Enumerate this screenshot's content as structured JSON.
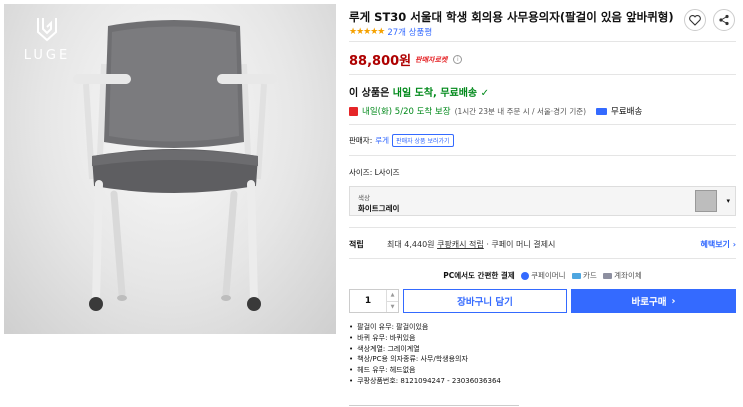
{
  "brand": {
    "logo_text": "LUGE"
  },
  "product": {
    "title": "루게 ST30 서울대 학생 회의용 사무용의자(팔걸이 있음 앞바퀴형)",
    "stars": "★★★★★",
    "review_count": "27개 상품평",
    "price": "88,800원",
    "rocket_badge": "판매자로켓",
    "info_glyph": "i"
  },
  "delivery": {
    "headline_prefix": "이 상품은 ",
    "headline_green": "내일 도착, 무료배송",
    "check": "✓",
    "arrival": "내일(화) 5/20 도착 보장",
    "arrival_note": "(1시간 23분  내 주문 시 / 서울·경기 기준)",
    "shipping": "무료배송"
  },
  "seller": {
    "label": "판매자:",
    "name": "루게",
    "more_button": "판매자 상품 보러가기"
  },
  "options": {
    "size_label": "사이즈: L사이즈",
    "color_small_label": "색상",
    "color_value": "화이트그레이",
    "caret": "▾"
  },
  "points": {
    "label": "적립",
    "detail_prefix": "최대 4,440원 ",
    "detail_link": "쿠팡캐시 적립",
    "detail_suffix": " · 쿠페이 머니 결제시",
    "more": "혜택보기 ›"
  },
  "payment": {
    "headline": "PC에서도 간편한 결제",
    "options": [
      "쿠페이머니",
      "카드",
      "계좌이체"
    ]
  },
  "purchase": {
    "quantity": "1",
    "up": "▲",
    "down": "▼",
    "cart_label": "장바구니 담기",
    "buy_label": "바로구매",
    "buy_arrow": "›"
  },
  "specs": [
    "팔걸이 유무: 팔걸이있음",
    "바퀴 유무: 바퀴있음",
    "색상계열: 그레이계열",
    "책상/PC용 의자종류: 사무/학생용의자",
    "헤드 유무: 헤드없음",
    "쿠팡상품번호: 8121094247 - 23036036364"
  ],
  "icons": {
    "heart": "heart-icon",
    "share": "share-icon",
    "calendar": "calendar-icon",
    "truck": "truck-icon"
  },
  "colors": {
    "accent": "#346aff",
    "price": "#ae0000",
    "green": "#00891a",
    "star": "#f5a100"
  }
}
